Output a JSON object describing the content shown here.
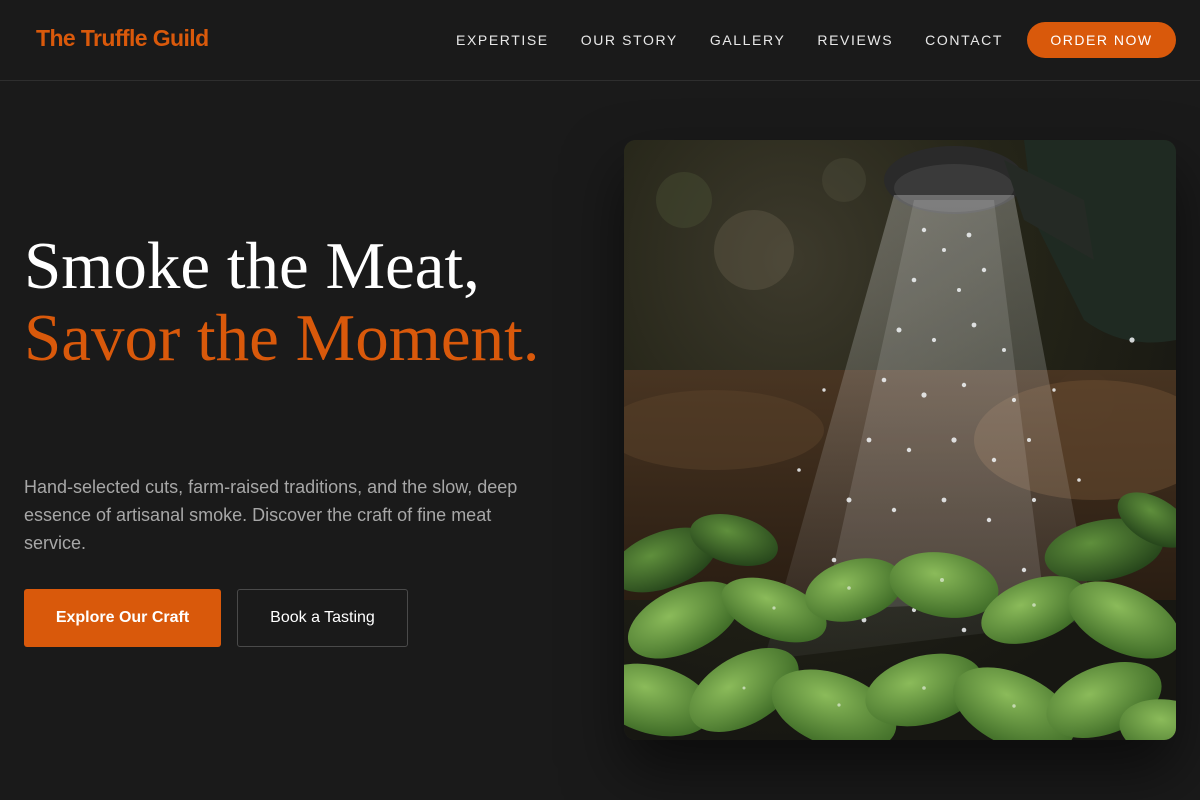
{
  "header": {
    "logo": "The Truffle Guild",
    "nav": [
      {
        "label": "EXPERTISE"
      },
      {
        "label": "OUR STORY"
      },
      {
        "label": "GALLERY"
      },
      {
        "label": "REVIEWS"
      },
      {
        "label": "CONTACT"
      }
    ],
    "order_label": "ORDER NOW"
  },
  "hero": {
    "title_line1": "Smoke the Meat,",
    "title_accent": "Savor the Moment.",
    "description": "Hand-selected cuts, farm-raised traditions, and the slow, deep essence of artisanal smoke. Discover the craft of fine meat service.",
    "primary_cta": "Explore Our Craft",
    "secondary_cta": "Book a Tasting",
    "image_subject": "watering-can-over-seedlings"
  },
  "colors": {
    "accent": "#d9590b",
    "background": "#1a1a1a",
    "text": "#ffffff",
    "muted_text": "#a7a7a7"
  }
}
